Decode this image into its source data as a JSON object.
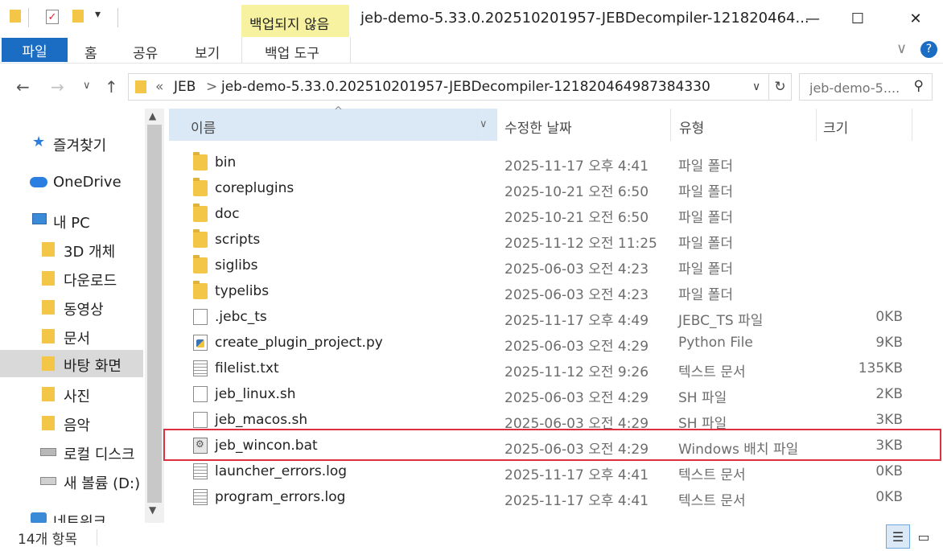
{
  "title_bar": {
    "context_tab_label": "백업되지 않음",
    "window_title": "jeb-demo-5.33.0.202510201957-JEBDecompiler-121820464...",
    "minimize": "—",
    "maximize": "☐",
    "close": "✕"
  },
  "ribbon": {
    "file_tab": "파일",
    "tabs": [
      "홈",
      "공유",
      "보기"
    ],
    "context_tab": "백업 도구",
    "collapse": "∨",
    "help": "?"
  },
  "address_bar": {
    "back": "←",
    "forward": "→",
    "recent": "∨",
    "up": "↑",
    "overflow": "«",
    "crumbs": [
      "JEB",
      "jeb-demo-5.33.0.202510201957-JEBDecompiler-121820464987384330"
    ],
    "separator": ">",
    "dropdown": "∨",
    "refresh": "↻",
    "search_placeholder": "jeb-demo-5....",
    "search_icon": "search-icon"
  },
  "nav_pane": {
    "items": [
      {
        "label": "즐겨찾기",
        "icon": "star-icon"
      },
      {
        "label": "OneDrive",
        "icon": "cloud-icon"
      },
      {
        "label": "내 PC",
        "icon": "computer-icon"
      },
      {
        "label": "3D 개체",
        "icon": "cube-folder-icon"
      },
      {
        "label": "다운로드",
        "icon": "download-folder-icon"
      },
      {
        "label": "동영상",
        "icon": "video-folder-icon"
      },
      {
        "label": "문서",
        "icon": "document-folder-icon"
      },
      {
        "label": "바탕 화면",
        "icon": "desktop-folder-icon"
      },
      {
        "label": "사진",
        "icon": "pictures-folder-icon"
      },
      {
        "label": "음악",
        "icon": "music-folder-icon"
      },
      {
        "label": "로컬 디스크",
        "icon": "drive-icon"
      },
      {
        "label": "새 볼륨 (D:)",
        "icon": "drive-icon"
      },
      {
        "label": "네트워크",
        "icon": "network-icon"
      }
    ],
    "selected": "바탕 화면"
  },
  "columns": {
    "name": "이름",
    "date": "수정한 날짜",
    "type": "유형",
    "size": "크기",
    "sort_indicator": "^",
    "name_dropdown": "∨"
  },
  "files": [
    {
      "name": "bin",
      "date": "2025-11-17 오후 4:41",
      "type": "파일 폴더",
      "size": "",
      "icon": "folder-icon"
    },
    {
      "name": "coreplugins",
      "date": "2025-10-21 오전 6:50",
      "type": "파일 폴더",
      "size": "",
      "icon": "folder-icon"
    },
    {
      "name": "doc",
      "date": "2025-10-21 오전 6:50",
      "type": "파일 폴더",
      "size": "",
      "icon": "folder-icon"
    },
    {
      "name": "scripts",
      "date": "2025-11-12 오전 11:25",
      "type": "파일 폴더",
      "size": "",
      "icon": "folder-icon"
    },
    {
      "name": "siglibs",
      "date": "2025-06-03 오전 4:23",
      "type": "파일 폴더",
      "size": "",
      "icon": "folder-icon"
    },
    {
      "name": "typelibs",
      "date": "2025-06-03 오전 4:23",
      "type": "파일 폴더",
      "size": "",
      "icon": "folder-icon"
    },
    {
      "name": ".jebc_ts",
      "date": "2025-11-17 오후 4:49",
      "type": "JEBC_TS 파일",
      "size": "0KB",
      "icon": "file-icon"
    },
    {
      "name": "create_plugin_project.py",
      "date": "2025-06-03 오전 4:29",
      "type": "Python File",
      "size": "9KB",
      "icon": "python-file-icon"
    },
    {
      "name": "filelist.txt",
      "date": "2025-11-12 오전 9:26",
      "type": "텍스트 문서",
      "size": "135KB",
      "icon": "text-file-icon"
    },
    {
      "name": "jeb_linux.sh",
      "date": "2025-06-03 오전 4:29",
      "type": "SH 파일",
      "size": "2KB",
      "icon": "file-icon"
    },
    {
      "name": "jeb_macos.sh",
      "date": "2025-06-03 오전 4:29",
      "type": "SH 파일",
      "size": "3KB",
      "icon": "file-icon"
    },
    {
      "name": "jeb_wincon.bat",
      "date": "2025-06-03 오전 4:29",
      "type": "Windows 배치 파일",
      "size": "3KB",
      "icon": "batch-file-icon"
    },
    {
      "name": "launcher_errors.log",
      "date": "2025-11-17 오후 4:41",
      "type": "텍스트 문서",
      "size": "0KB",
      "icon": "text-file-icon"
    },
    {
      "name": "program_errors.log",
      "date": "2025-11-17 오후 4:41",
      "type": "텍스트 문서",
      "size": "0KB",
      "icon": "text-file-icon"
    }
  ],
  "highlighted_file": "jeb_wincon.bat",
  "status_bar": {
    "item_count": "14개 항목"
  },
  "colors": {
    "file_tab_bg": "#1a6dc2",
    "context_tab_bg": "#f6f2a0",
    "highlight_border": "#e03040",
    "header_selected_bg": "#dbe9f7",
    "folder_yellow": "#f4c648"
  }
}
